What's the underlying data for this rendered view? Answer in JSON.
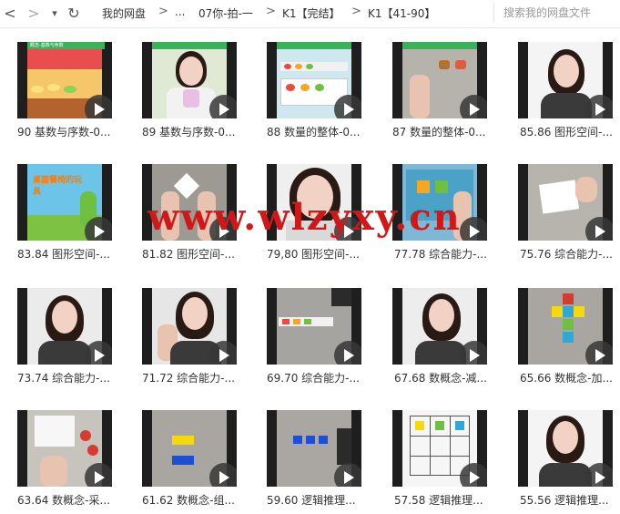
{
  "toolbar": {
    "back_label": "<",
    "forward_label": ">",
    "dropdown_label": "▾",
    "refresh_label": "↻",
    "breadcrumbs": [
      "我的网盘",
      "...",
      "07你-拍-一",
      "K1【完结】",
      "K1【41-90】"
    ],
    "separator": ">",
    "search_placeholder": "搜索我的网盘文件"
  },
  "files": [
    {
      "label": "90 基数与序数-0..."
    },
    {
      "label": "89 基数与序数-0..."
    },
    {
      "label": "88 数量的整体-0..."
    },
    {
      "label": "87 数量的整体-0..."
    },
    {
      "label": "85.86 图形空间-..."
    },
    {
      "label": "83.84 图形空间-..."
    },
    {
      "label": "81.82 图形空间-..."
    },
    {
      "label": "79,80 图形空间-..."
    },
    {
      "label": "77.78 综合能力-..."
    },
    {
      "label": "75.76 综合能力-..."
    },
    {
      "label": "73.74 综合能力-..."
    },
    {
      "label": "71.72 综合能力-..."
    },
    {
      "label": "69.70 综合能力-..."
    },
    {
      "label": "67.68 数概念-减..."
    },
    {
      "label": "65.66 数概念-加..."
    },
    {
      "label": "63.64 数概念-采..."
    },
    {
      "label": "61.62 数概念-组..."
    },
    {
      "label": "59.60 逻辑推理..."
    },
    {
      "label": "57.58 逻辑推理..."
    },
    {
      "label": "55.56 逻辑推理..."
    }
  ],
  "thumb_texts": {
    "t0_header": "概念-基数与序数",
    "t5_title": "桌面餐椅的玩具"
  },
  "watermark": "www.wlzyxy.cn",
  "colors": {
    "accent": "#d01818",
    "text": "#333333"
  }
}
